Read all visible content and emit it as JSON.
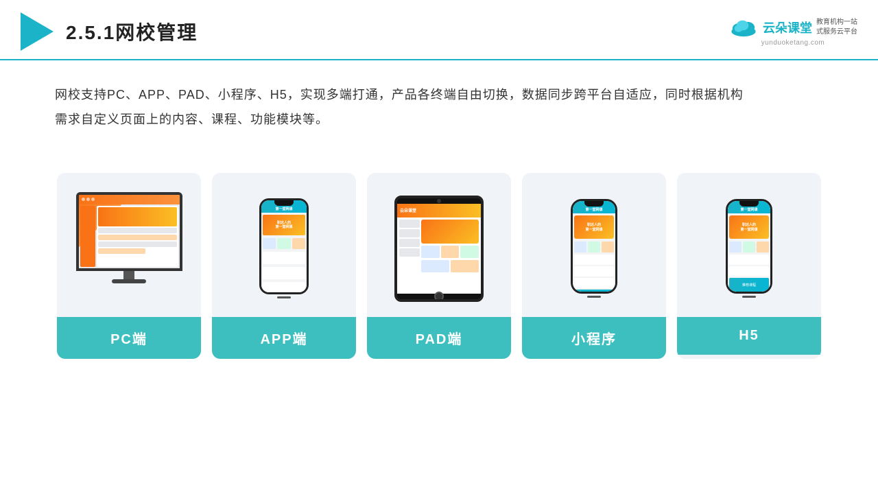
{
  "header": {
    "title": "2.5.1网校管理",
    "brand_name": "云朵课堂",
    "brand_url": "yunduoketang.com",
    "brand_tagline": "教育机构一站\n式服务云平台"
  },
  "description": {
    "text": "网校支持PC、APP、PAD、小程序、H5，实现多端打通，产品各终端自由切换，数据同步跨平台自适应，同时根据机构需求自定义页面上的内容、课程、功能模块等。"
  },
  "cards": [
    {
      "id": "pc",
      "label": "PC端"
    },
    {
      "id": "app",
      "label": "APP端"
    },
    {
      "id": "pad",
      "label": "PAD端"
    },
    {
      "id": "miniprogram",
      "label": "小程序"
    },
    {
      "id": "h5",
      "label": "H5"
    }
  ],
  "colors": {
    "teal": "#3dbfbf",
    "accent": "#1ab3c8",
    "header_border": "#1ab3c8"
  }
}
